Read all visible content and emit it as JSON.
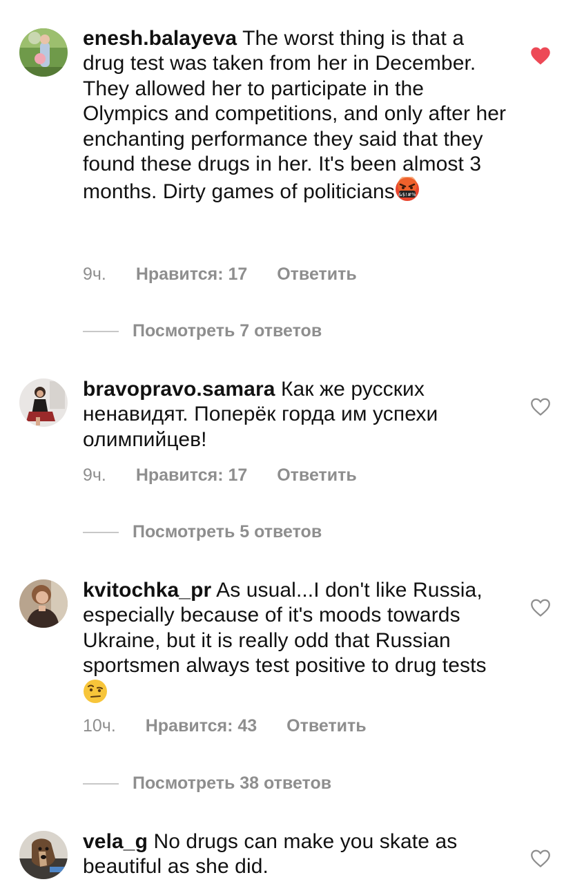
{
  "comments": [
    {
      "username": "enesh.balayeva",
      "text": "The worst thing is that a drug test was taken from her in December. They allowed her to participate in the Olympics and competitions, and only after her enchanting performance they said that they found these drugs in her. It's been almost 3 months. Dirty games of politicians",
      "emoji": "face-with-symbols-on-mouth",
      "time": "9ч.",
      "likes": "Нравится: 17",
      "reply": "Ответить",
      "replies": "Посмотреть 7 ответов",
      "liked": true
    },
    {
      "username": "bravopravo.samara",
      "text": "Как же русских ненавидят. Поперёк горда им успехи олимпийцев!",
      "time": "9ч.",
      "likes": "Нравится: 17",
      "reply": "Ответить",
      "replies": "Посмотреть 5 ответов",
      "liked": false
    },
    {
      "username": "kvitochka_pr",
      "text": "As usual...I don't like Russia, especially because of it's moods towards Ukraine, but it is really odd that Russian sportsmen always test positive to drug tests",
      "emoji": "face-with-raised-eyebrow",
      "time": "10ч.",
      "likes": "Нравится: 43",
      "reply": "Ответить",
      "replies": "Посмотреть 38 ответов",
      "liked": false
    },
    {
      "username": "vela_g",
      "text": "No drugs can make you skate as beautiful as she did.",
      "liked": false
    }
  ],
  "colors": {
    "liked_heart": "#ed4956",
    "meta_text": "#8e8e8e",
    "outline_heart": "#8e8e8e"
  }
}
